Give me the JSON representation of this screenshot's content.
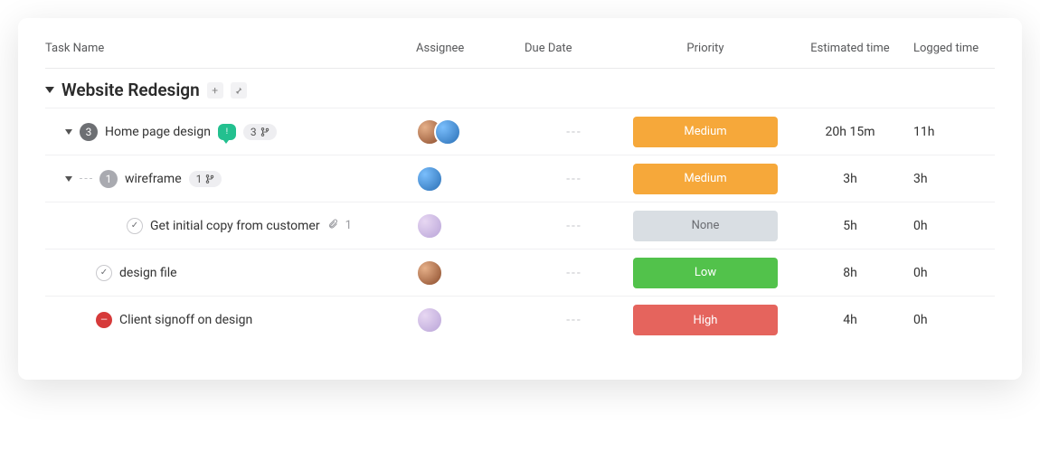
{
  "columns": {
    "task": "Task Name",
    "assignee": "Assignee",
    "due": "Due Date",
    "priority": "Priority",
    "estimated": "Estimated time",
    "logged": "Logged time"
  },
  "group": {
    "title": "Website Redesign"
  },
  "due_empty": "---",
  "priority_labels": {
    "medium": "Medium",
    "none": "None",
    "low": "Low",
    "high": "High"
  },
  "rows": [
    {
      "name": "Home page design",
      "subtask_count": "3",
      "branch_count": "3",
      "estimated": "20h 15m",
      "logged": "11h"
    },
    {
      "name": "wireframe",
      "subtask_count": "1",
      "branch_count": "1",
      "estimated": "3h",
      "logged": "3h"
    },
    {
      "name": "Get initial copy from customer",
      "attach_count": "1",
      "estimated": "5h",
      "logged": "0h"
    },
    {
      "name": "design file",
      "estimated": "8h",
      "logged": "0h"
    },
    {
      "name": "Client signoff on design",
      "estimated": "4h",
      "logged": "0h"
    }
  ]
}
